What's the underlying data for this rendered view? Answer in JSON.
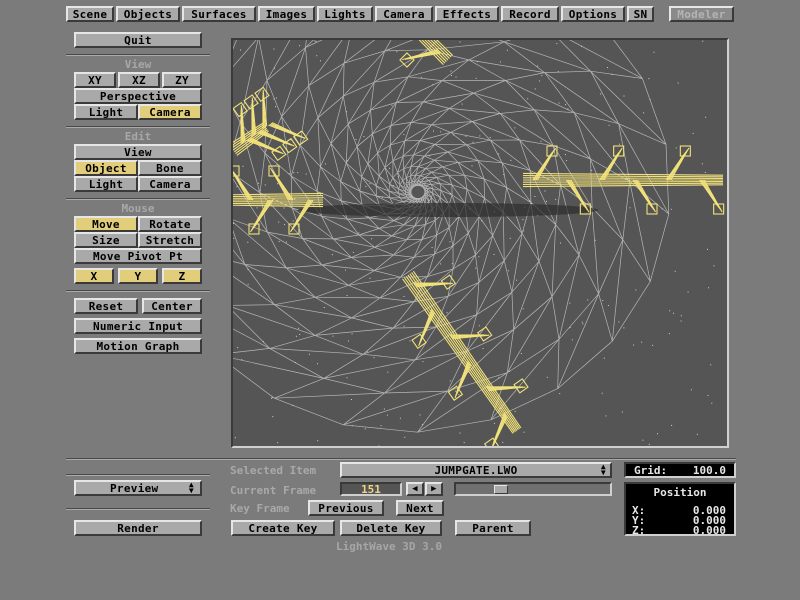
{
  "menu": {
    "tabs": [
      "Scene",
      "Objects",
      "Surfaces",
      "Images",
      "Lights",
      "Camera",
      "Effects",
      "Record",
      "Options",
      "SN"
    ],
    "modeler": "Modeler"
  },
  "left": {
    "quit": "Quit",
    "view_title": "View",
    "view_xy": "XY",
    "view_xz": "XZ",
    "view_zy": "ZY",
    "perspective": "Perspective",
    "view_light": "Light",
    "view_camera": "Camera",
    "edit_title": "Edit",
    "edit_view": "View",
    "edit_object": "Object",
    "edit_bone": "Bone",
    "edit_light": "Light",
    "edit_camera": "Camera",
    "mouse_title": "Mouse",
    "move": "Move",
    "rotate": "Rotate",
    "size": "Size",
    "stretch": "Stretch",
    "move_pivot": "Move Pivot Pt",
    "axis_x": "X",
    "axis_y": "Y",
    "axis_z": "Z",
    "reset": "Reset",
    "center": "Center",
    "numeric_input": "Numeric Input",
    "motion_graph": "Motion Graph",
    "preview": "Preview",
    "render": "Render"
  },
  "bottom": {
    "selected_item_label": "Selected Item",
    "selected_item_value": "JUMPGATE.LWO",
    "current_frame_label": "Current Frame",
    "current_frame_value": "151",
    "frame_slider_position": 0.27,
    "key_frame_label": "Key Frame",
    "previous": "Previous",
    "next": "Next",
    "create_key": "Create Key",
    "delete_key": "Delete Key",
    "parent": "Parent",
    "footer": "LightWave 3D 3.0"
  },
  "info": {
    "grid_label": "Grid:",
    "grid_value": "100.0",
    "position_title": "Position",
    "x_label": "X:",
    "x_value": "0.000",
    "y_label": "Y:",
    "y_value": "0.000",
    "z_label": "Z:",
    "z_value": "0.000"
  },
  "icons": {
    "dropdown": "updown-arrows-icon",
    "prev_frame": "left-arrow-icon",
    "next_frame": "right-arrow-icon"
  },
  "colors": {
    "background": "#7b7b7b",
    "button": "#a9a9a9",
    "active_button": "#e2cd7a",
    "wireframe_yellow": "#f2e27a",
    "wireframe_white": "#cfcfcf"
  }
}
